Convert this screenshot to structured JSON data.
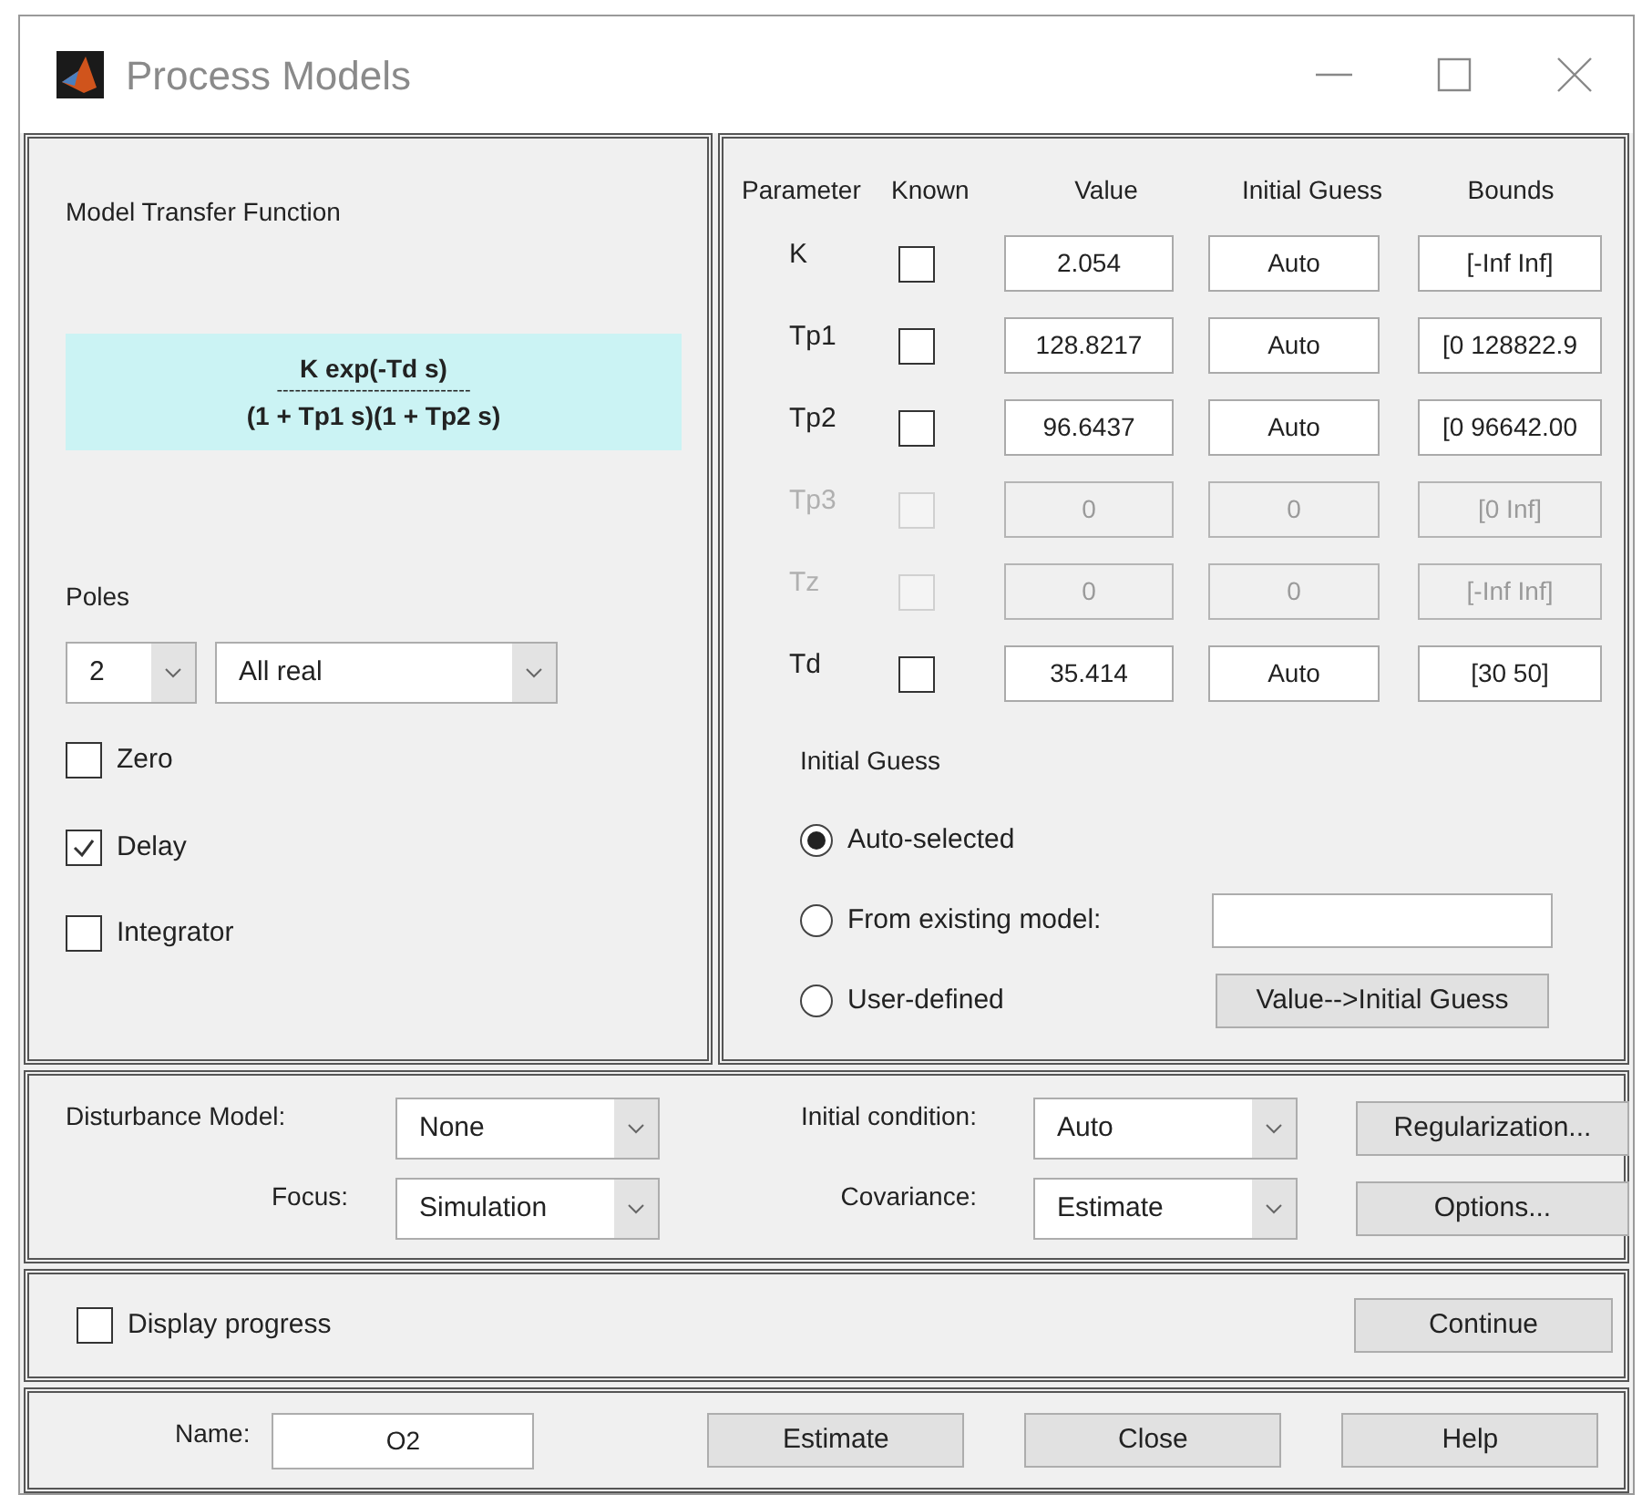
{
  "window": {
    "title": "Process Models"
  },
  "model_structure": {
    "heading": "Model Transfer Function",
    "formula": {
      "numerator": "K exp(-Td s)",
      "fraction_bar": "--------------------------------",
      "denominator": "(1 + Tp1 s)(1 + Tp2 s)"
    },
    "poles_label": "Poles",
    "poles_count": "2",
    "poles_type": "All real",
    "options": [
      {
        "label": "Zero",
        "checked": false
      },
      {
        "label": "Delay",
        "checked": true
      },
      {
        "label": "Integrator",
        "checked": false
      }
    ]
  },
  "parameters": {
    "columns": [
      "Parameter",
      "Known",
      "Value",
      "Initial Guess",
      "Bounds"
    ],
    "rows": [
      {
        "name": "K",
        "known": false,
        "disabled": false,
        "value": "2.054",
        "initial_guess": "Auto",
        "bounds": "[-Inf Inf]"
      },
      {
        "name": "Tp1",
        "known": false,
        "disabled": false,
        "value": "128.8217",
        "initial_guess": "Auto",
        "bounds": "[0 128822.9"
      },
      {
        "name": "Tp2",
        "known": false,
        "disabled": false,
        "value": "96.6437",
        "initial_guess": "Auto",
        "bounds": "[0 96642.00"
      },
      {
        "name": "Tp3",
        "known": false,
        "disabled": true,
        "value": "0",
        "initial_guess": "0",
        "bounds": "[0 Inf]"
      },
      {
        "name": "Tz",
        "known": false,
        "disabled": true,
        "value": "0",
        "initial_guess": "0",
        "bounds": "[-Inf Inf]"
      },
      {
        "name": "Td",
        "known": false,
        "disabled": false,
        "value": "35.414",
        "initial_guess": "Auto",
        "bounds": "[30 50]"
      }
    ]
  },
  "initial_guess": {
    "heading": "Initial Guess",
    "options": [
      {
        "label": "Auto-selected",
        "selected": true
      },
      {
        "label": "From existing model:",
        "selected": false
      },
      {
        "label": "User-defined",
        "selected": false
      }
    ],
    "copy_button": "Value-->Initial Guess"
  },
  "settings": {
    "disturbance_model": {
      "label": "Disturbance Model:",
      "value": "None"
    },
    "focus": {
      "label": "Focus:",
      "value": "Simulation"
    },
    "initial_condition": {
      "label": "Initial condition:",
      "value": "Auto"
    },
    "covariance": {
      "label": "Covariance:",
      "value": "Estimate"
    },
    "buttons": [
      "Regularization...",
      "Options..."
    ]
  },
  "progress": {
    "label": "Display progress",
    "checked": false,
    "button": "Continue"
  },
  "footer": {
    "name_label": "Name:",
    "name_value": "O2",
    "buttons": [
      "Estimate",
      "Close",
      "Help"
    ]
  }
}
